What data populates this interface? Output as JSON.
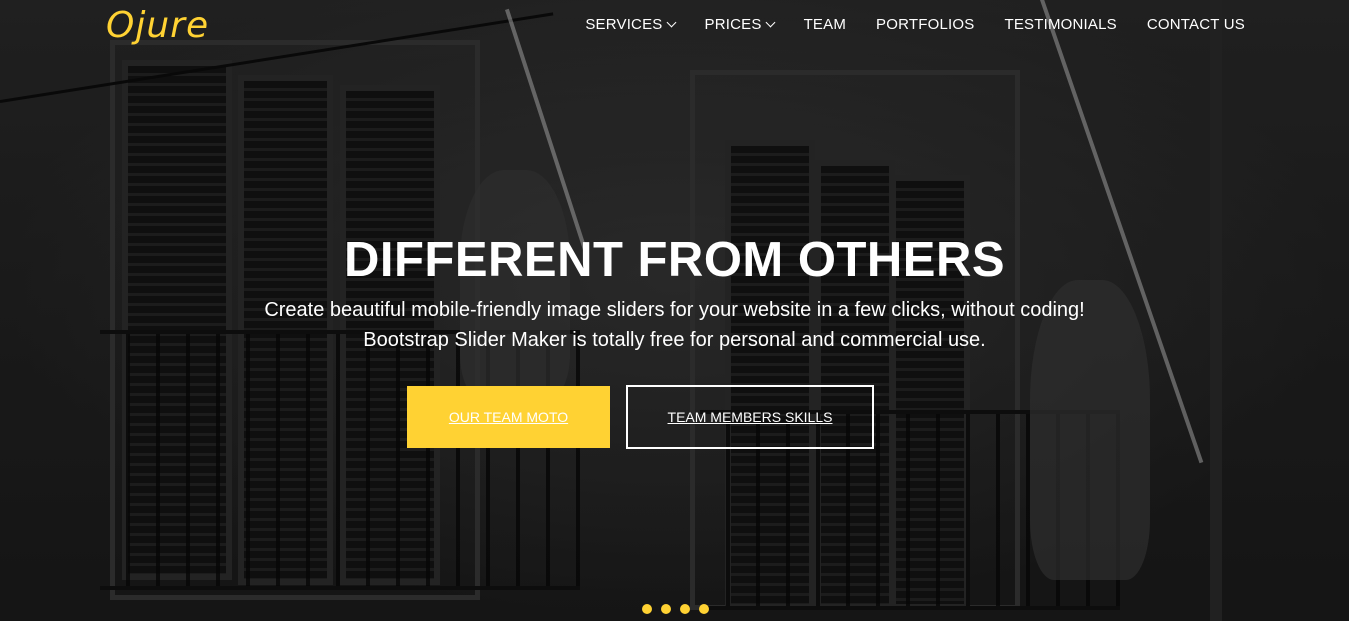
{
  "brand": {
    "logo_text": "Ojure",
    "accent_color": "#ffd233"
  },
  "nav": {
    "items": [
      {
        "label": "SERVICES",
        "has_dropdown": true
      },
      {
        "label": "PRICES",
        "has_dropdown": true
      },
      {
        "label": "TEAM",
        "has_dropdown": false
      },
      {
        "label": "PORTFOLIOS",
        "has_dropdown": false
      },
      {
        "label": "TESTIMONIALS",
        "has_dropdown": false
      },
      {
        "label": "CONTACT US",
        "has_dropdown": false
      }
    ]
  },
  "hero": {
    "title": "DIFFERENT FROM OTHERS",
    "subtitle_line1": "Create beautiful mobile-friendly image sliders for your website in a few clicks, without coding!",
    "subtitle_line2": "Bootstrap Slider Maker is totally free for personal and commercial use.",
    "primary_button": "OUR TEAM MOTO",
    "secondary_button": "TEAM MEMBERS SKILLS",
    "background_image": "grayscale photo of painters on balconies"
  },
  "slider": {
    "dot_count": 4,
    "dot_color": "#ffd233"
  }
}
